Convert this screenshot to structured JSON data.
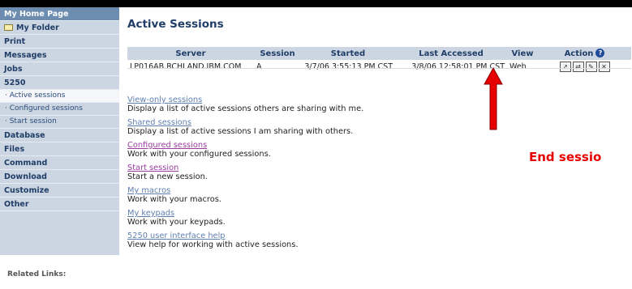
{
  "sidebar": {
    "home": "My Home Page",
    "folder": "My Folder",
    "items_top": [
      "Print",
      "Messages",
      "Jobs",
      "5250"
    ],
    "sub_items": [
      "· Active sessions",
      "· Configured sessions",
      "· Start session"
    ],
    "items_bottom": [
      "Database",
      "Files",
      "Command",
      "Download",
      "Customize",
      "Other"
    ],
    "related_links": "Related Links:"
  },
  "main": {
    "title": "Active Sessions",
    "table": {
      "headers": [
        "Server",
        "Session",
        "Started",
        "Last Accessed",
        "View",
        "Action"
      ],
      "row": {
        "server": "LP016AB.RCHLAND.IBM.COM",
        "session": "A",
        "started": "3/7/06 3:55:13 PM CST",
        "last_accessed": "3/8/06 12:58:01 PM CST",
        "view": "Web"
      },
      "action_icons": [
        "open-session-icon",
        "share-session-icon",
        "edit-session-icon",
        "end-session-icon"
      ]
    },
    "links": [
      {
        "label": "View-only sessions",
        "desc": "Display a list of active sessions others are sharing with me."
      },
      {
        "label": "Shared sessions",
        "desc": "Display a list of active sessions I am sharing with others."
      },
      {
        "label": "Configured sessions",
        "desc": "Work with your configured sessions."
      },
      {
        "label": "Start session",
        "desc": "Start a new session."
      },
      {
        "label": "My macros",
        "desc": "Work with your macros."
      },
      {
        "label": "My keypads",
        "desc": "Work with your keypads."
      },
      {
        "label": "5250 user interface help",
        "desc": "View help for working with active sessions."
      }
    ]
  },
  "annotation": {
    "label": "End sessio",
    "color": "#e60000"
  },
  "colors": {
    "sidebar_bg": "#ccd6e2",
    "home_bg": "#6c8cb0",
    "link": "#5f7fb0",
    "visited_link": "#9a3ca0",
    "title": "#1f3d66"
  }
}
